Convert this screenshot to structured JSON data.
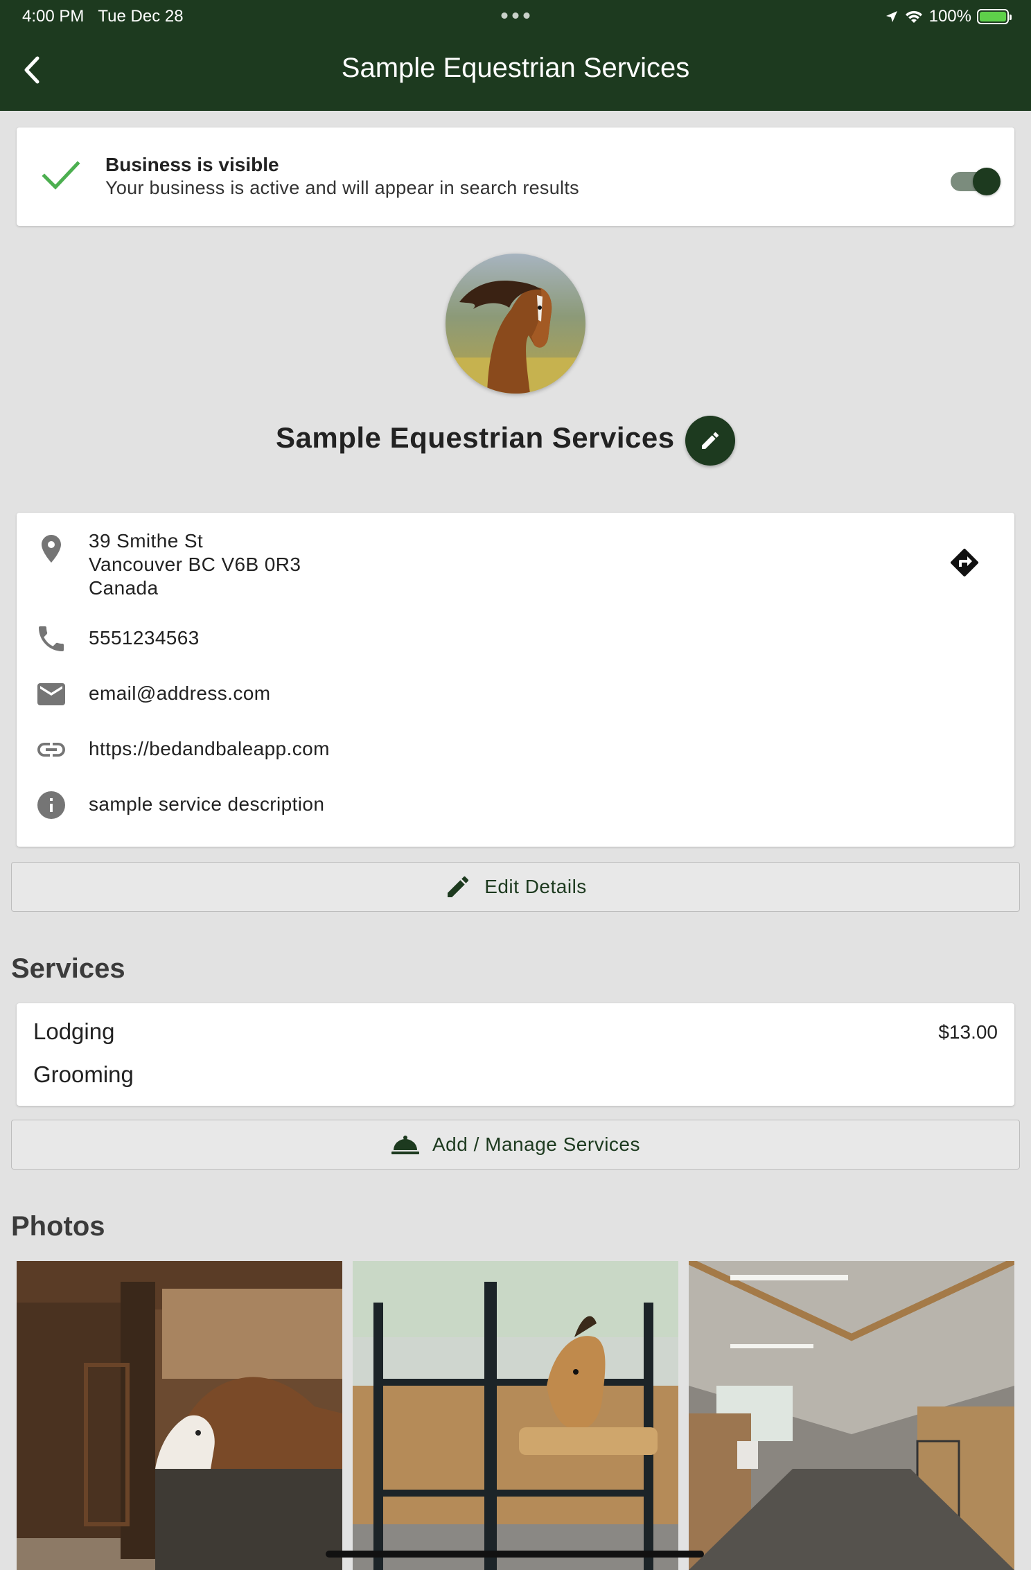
{
  "status_bar": {
    "time": "4:00 PM",
    "date": "Tue Dec 28",
    "battery": "100%"
  },
  "nav": {
    "title": "Sample Equestrian Services"
  },
  "visibility": {
    "title": "Business is visible",
    "subtitle": "Your business is active and will appear in search results",
    "toggle_on": true
  },
  "business": {
    "name": "Sample Equestrian Services"
  },
  "contact": {
    "address_line1": "39 Smithe St",
    "address_line2": "Vancouver BC V6B 0R3",
    "address_line3": "Canada",
    "phone": "5551234563",
    "email": "email@address.com",
    "website": "https://bedandbaleapp.com",
    "description": "sample service description"
  },
  "buttons": {
    "edit_details": "Edit Details",
    "manage_services": "Add / Manage Services"
  },
  "services": {
    "title": "Services",
    "items": [
      {
        "name": "Lodging",
        "price": "$13.00"
      },
      {
        "name": "Grooming",
        "price": ""
      }
    ]
  },
  "photos": {
    "title": "Photos"
  },
  "colors": {
    "brand": "#1d3a1f",
    "check": "#4caf50",
    "background": "#e2e2e2"
  }
}
